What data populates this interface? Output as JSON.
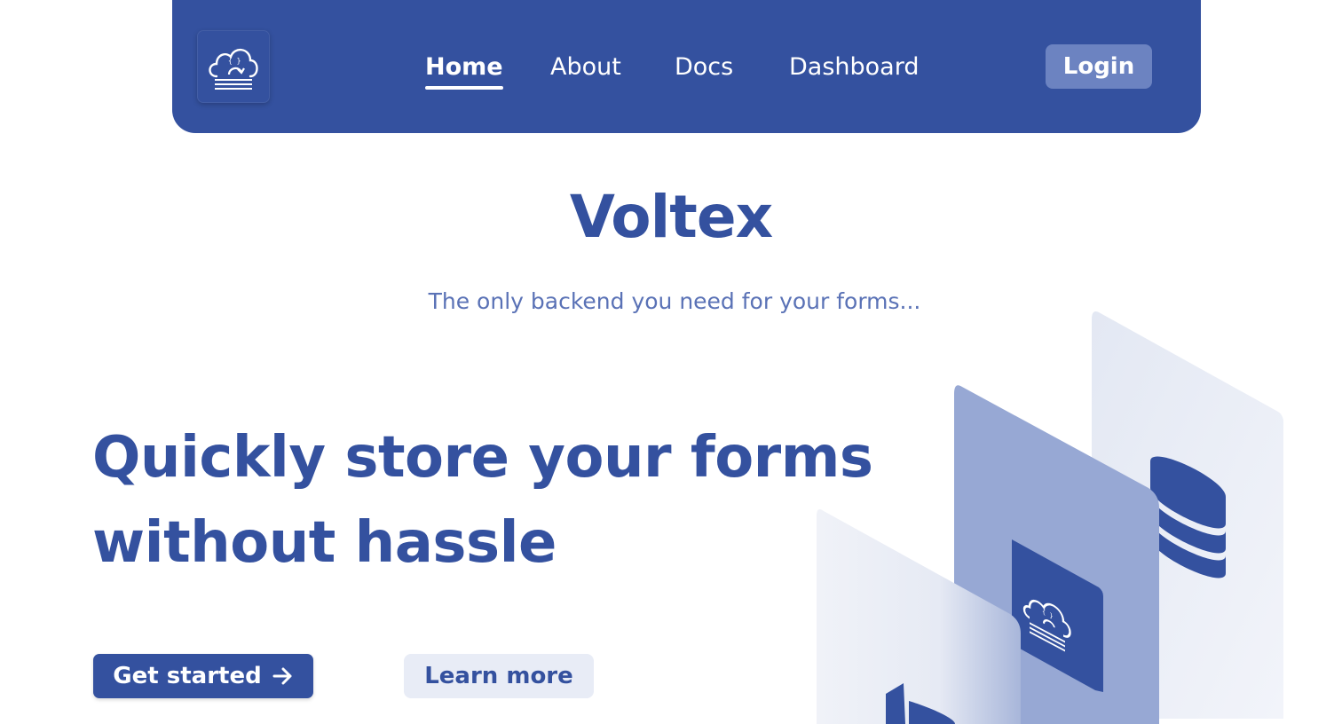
{
  "nav": {
    "links": [
      {
        "label": "Home",
        "active": true
      },
      {
        "label": "About",
        "active": false
      },
      {
        "label": "Docs",
        "active": false
      },
      {
        "label": "Dashboard",
        "active": false
      }
    ],
    "login_label": "Login",
    "logo_icon": "cloud-upload-icon"
  },
  "hero": {
    "brand": "Voltex",
    "tagline": "The only backend you need for your forms...",
    "headline": "Quickly store your forms without hassle",
    "primary_button": "Get started",
    "primary_button_icon": "arrow-right-icon",
    "secondary_button": "Learn more"
  },
  "illustration": {
    "icons": [
      "cloud-upload-icon",
      "database-icon"
    ]
  },
  "colors": {
    "primary": "#34519f",
    "accent": "#6c83c1",
    "light": "#e8ecf6"
  }
}
